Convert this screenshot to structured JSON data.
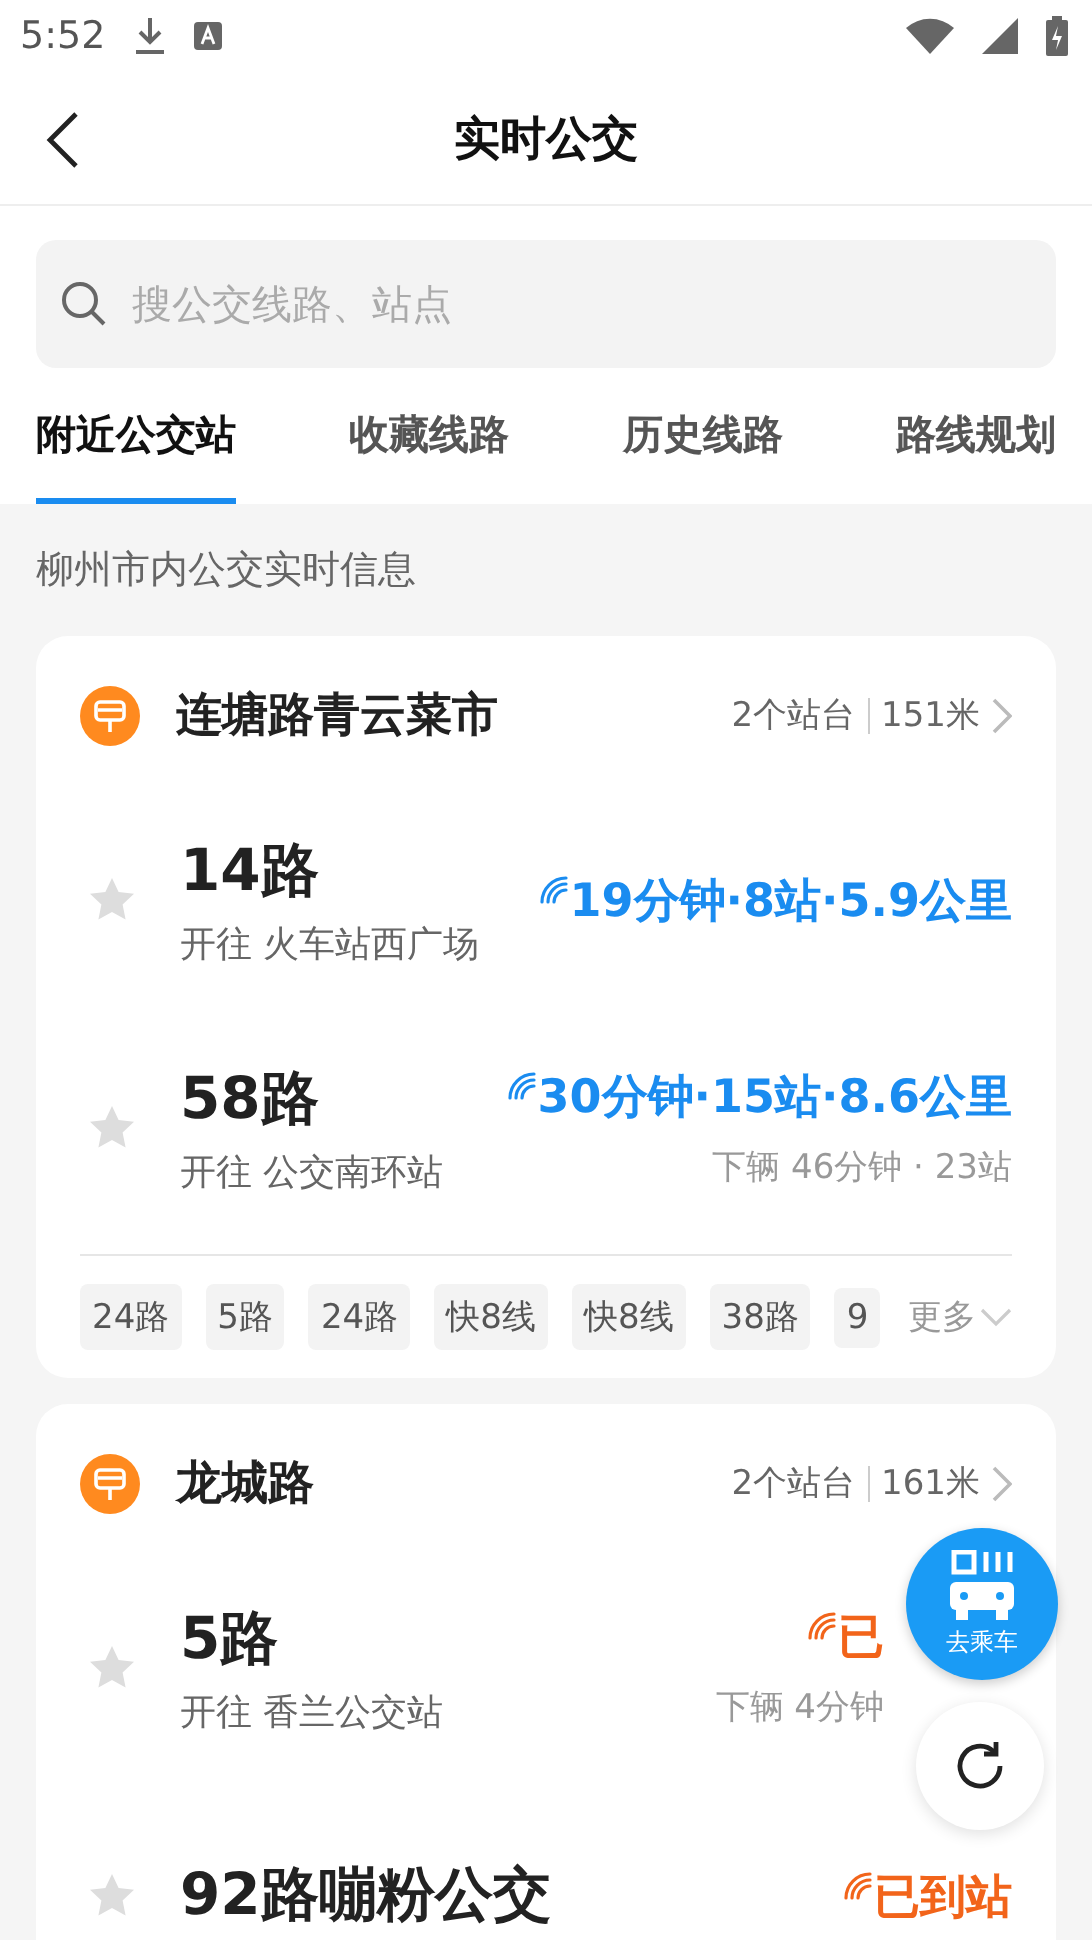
{
  "status_bar": {
    "time": "5:52"
  },
  "header": {
    "title": "实时公交"
  },
  "search": {
    "placeholder": "搜公交线路、站点"
  },
  "tabs": [
    {
      "label": "附近公交站",
      "selected": true
    },
    {
      "label": "收藏线路",
      "selected": false
    },
    {
      "label": "历史线路",
      "selected": false
    },
    {
      "label": "路线规划",
      "selected": false
    }
  ],
  "section_label": "柳州市内公交实时信息",
  "stations": [
    {
      "name": "连塘路青云菜市",
      "platforms": "2个站台",
      "distance": "151米",
      "routes": [
        {
          "name": "14路",
          "direction": "开往 火车站西广场",
          "kind": "eta",
          "arrival": "19分钟·8站·5.9公里",
          "starred": false
        },
        {
          "name": "58路",
          "direction": "开往 公交南环站",
          "kind": "eta",
          "arrival": "30分钟·15站·8.6公里",
          "next": "下辆 46分钟 · 23站",
          "starred": false
        }
      ],
      "chips": [
        "24路",
        "5路",
        "24路",
        "快8线",
        "快8线",
        "38路",
        "9"
      ],
      "more": "更多"
    },
    {
      "name": "龙城路",
      "platforms": "2个站台",
      "distance": "161米",
      "routes": [
        {
          "name": "5路",
          "direction": "开往 香兰公交站",
          "kind": "arrived",
          "arrival": "已",
          "next": "下辆 4分钟",
          "starred": false
        },
        {
          "name": "92路嘣粉公交",
          "kind": "arrived",
          "arrival": "已到站",
          "starred": false
        }
      ]
    }
  ],
  "fab": {
    "label": "去乘车"
  }
}
